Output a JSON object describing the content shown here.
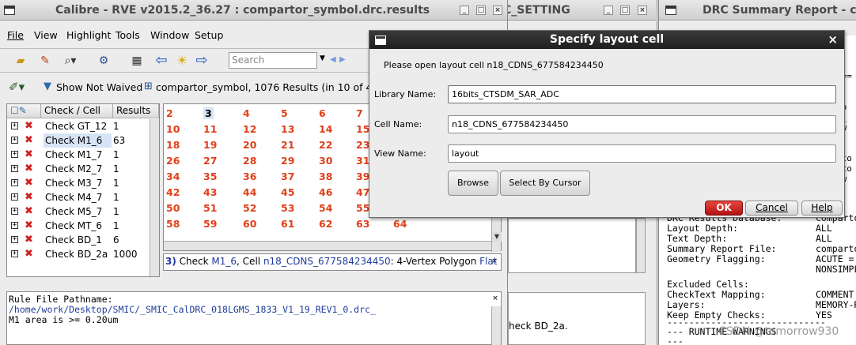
{
  "rve": {
    "title": "Calibre - RVE v2015.2_36.27 : compartor_symbol.drc.results",
    "menus": [
      "File",
      "View",
      "Highlight",
      "Tools",
      "Window",
      "Setup"
    ],
    "search_placeholder": "Search",
    "show_not_waived": "Show Not Waived",
    "summary": "compartor_symbol, 1076 Results (in 10 of 423 C",
    "col_check": "Check / Cell",
    "col_results": "Results",
    "checks": [
      {
        "name": "Check GT_12",
        "results": "1"
      },
      {
        "name": "Check M1_6",
        "results": "63"
      },
      {
        "name": "Check M1_7",
        "results": "1"
      },
      {
        "name": "Check M2_7",
        "results": "1"
      },
      {
        "name": "Check M3_7",
        "results": "1"
      },
      {
        "name": "Check M4_7",
        "results": "1"
      },
      {
        "name": "Check M5_7",
        "results": "1"
      },
      {
        "name": "Check MT_6",
        "results": "1"
      },
      {
        "name": "Check BD_1",
        "results": "6"
      },
      {
        "name": "Check BD_2a",
        "results": "1000"
      }
    ],
    "result_numbers": [
      [
        "2",
        "3",
        "4",
        "5",
        "6",
        "7"
      ],
      [
        "10",
        "11",
        "12",
        "13",
        "14",
        "15"
      ],
      [
        "18",
        "19",
        "20",
        "21",
        "22",
        "23"
      ],
      [
        "26",
        "27",
        "28",
        "29",
        "30",
        "31"
      ],
      [
        "34",
        "35",
        "36",
        "37",
        "38",
        "39"
      ],
      [
        "42",
        "43",
        "44",
        "45",
        "46",
        "47"
      ],
      [
        "50",
        "51",
        "52",
        "53",
        "54",
        "55"
      ],
      [
        "58",
        "59",
        "60",
        "61",
        "62",
        "63",
        "64"
      ]
    ],
    "selected_result": "3",
    "detail": {
      "index": "3)",
      "check_word": "Check",
      "check": "M1_6",
      "cell_word": ", Cell",
      "cell": "n18_CDNS_677584234450",
      "desc": ": 4-Vertex Polygon",
      "flat": "Flat"
    },
    "rule_lines": [
      "Rule File Pathname:",
      "/home/work/Desktop/SMIC/_SMIC_CalDRC_018LGMS_1833_V1_19_REV1_0.drc_",
      "M1 area is >= 0.20um"
    ],
    "bottom_right_text": "heck BD_2a."
  },
  "bg_window": {
    "title_fragment": "C_SETTING"
  },
  "report": {
    "title": "DRC Summary Report - co",
    "rows": [
      {
        "k": "DRC Results Database:",
        "v": "comparto"
      },
      {
        "k": "Layout Depth:",
        "v": "ALL"
      },
      {
        "k": "Text Depth:",
        "v": "ALL"
      },
      {
        "k": "Summary Report File:",
        "v": "comparto"
      },
      {
        "k": "Geometry Flagging:",
        "v": "ACUTE ="
      },
      {
        "k": "",
        "v": "NONSIMPL"
      },
      {
        "k": "Excluded Cells:",
        "v": ""
      },
      {
        "k": "CheckText Mapping:",
        "v": "COMMENT"
      },
      {
        "k": "Layers:",
        "v": "MEMORY-R"
      },
      {
        "k": "Keep Empty Checks:",
        "v": "YES"
      }
    ],
    "divider": "-----------------------------",
    "runtime_warnings": "--- RUNTIME WARNINGS",
    "tail": "---",
    "edge_fragments": [
      "===",
      "T",
      "eb",
      "2_",
      "/w",
      "rto",
      "rto",
      "/w"
    ],
    "watermark": "CSDN @tomorrow930"
  },
  "dialog": {
    "title": "Specify layout cell",
    "prompt": "Please open layout cell n18_CDNS_677584234450",
    "library_label": "Library Name:",
    "library_value": "16bits_CTSDM_SAR_ADC",
    "cell_label": "Cell Name:",
    "cell_value": "n18_CDNS_677584234450",
    "view_label": "View Name:",
    "view_value": "layout",
    "browse": "Browse",
    "select_by_cursor": "Select By Cursor",
    "ok": "OK",
    "cancel": "Cancel",
    "help": "Help"
  },
  "colors": {
    "accent": "#1f3c9a",
    "red": "#cc1f1f",
    "number": "#e0401a"
  }
}
